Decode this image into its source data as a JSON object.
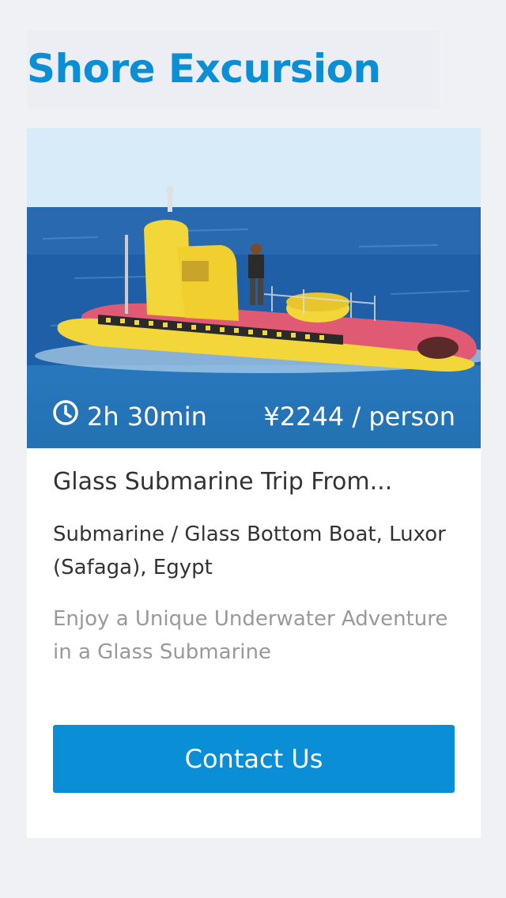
{
  "header": {
    "title": "Shore Excursion"
  },
  "card": {
    "image_alt": "Yellow glass submarine on blue sea",
    "duration": "2h 30min",
    "price": "¥2244 / person",
    "title": "Glass Submarine Trip From...",
    "category": "Submarine / Glass Bottom Boat, Luxor (Safaga), Egypt",
    "description": "Enjoy a Unique Underwater Adventure in a Glass Submarine",
    "contact_label": "Contact Us"
  },
  "colors": {
    "accent": "#0a8fd6",
    "title_text": "#333333",
    "muted_text": "#999999",
    "background": "#f0f1f5"
  },
  "icons": {
    "duration": "clock-icon"
  }
}
